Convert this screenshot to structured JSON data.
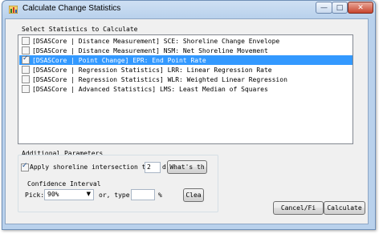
{
  "window": {
    "title": "Calculate Change Statistics",
    "controls": {
      "minimize": "—",
      "maximize": "□",
      "close": "✕"
    }
  },
  "statistics": {
    "label": "Select Statistics to Calculate",
    "items": [
      {
        "text": "[DSASCore | Distance Measurement] SCE: Shoreline Change Envelope",
        "checked": false,
        "selected": false
      },
      {
        "text": "[DSASCore | Distance Measurement] NSM: Net Shoreline Movement",
        "checked": false,
        "selected": false
      },
      {
        "text": "[DSASCore | Point Change] EPR: End Point Rate",
        "checked": true,
        "selected": true
      },
      {
        "text": "[DSASCore | Regression Statistics] LRR: Linear Regression Rate",
        "checked": false,
        "selected": false
      },
      {
        "text": "[DSASCore | Regression Statistics] WLR: Weighted Linear Regression",
        "checked": false,
        "selected": false
      },
      {
        "text": "[DSASCore | Advanced Statistics] LMS: Least Median of Squares",
        "checked": false,
        "selected": false
      }
    ]
  },
  "params": {
    "label": "Additional Parameters",
    "intersection_label": "Apply shoreline intersection thr",
    "intersection_checked": true,
    "intersection_value": "2",
    "intersection_unit": "d",
    "whats_this": "What's th",
    "confidence_label": "Confidence Interval",
    "pick_label": "Pick:",
    "pick_value": "90%",
    "or_type_label": "or, type:",
    "type_value": "",
    "percent": "%",
    "clear": "Clea"
  },
  "actions": {
    "cancel": "Cancel/Fi",
    "calculate": "Calculate"
  }
}
